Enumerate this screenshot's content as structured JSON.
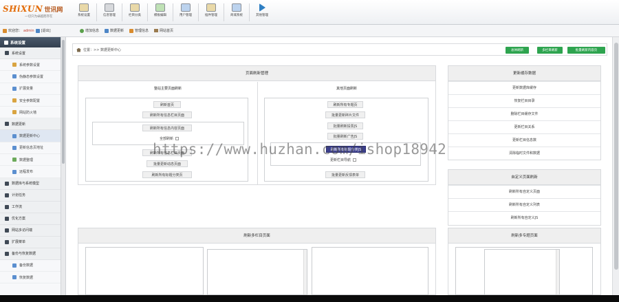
{
  "app": {
    "logo_main": "SHiXUN",
    "logo_cn": "世讯网",
    "logo_sub": "一切只为卓越而存在"
  },
  "topnav": [
    {
      "label": "系统设置",
      "icon": "settings-icon"
    },
    {
      "label": "信息管理",
      "icon": "calendar-icon"
    },
    {
      "label": "栏目分类",
      "icon": "folder-icon"
    },
    {
      "label": "模板编辑",
      "icon": "template-icon"
    },
    {
      "label": "用户管理",
      "icon": "monitor-icon"
    },
    {
      "label": "插件管理",
      "icon": "folder-icon"
    },
    {
      "label": "商城系统",
      "icon": "shop-icon"
    },
    {
      "label": "其他管理",
      "icon": "play-icon"
    }
  ],
  "subbar": {
    "welcome": "欢迎您：",
    "user": "admin",
    "logout": "[退出]",
    "quick": [
      "增加信息",
      "数据更新",
      "管理信息",
      "网站首页"
    ]
  },
  "sidebar": {
    "title": "系统设置",
    "groups": [
      {
        "label": "系统设置",
        "items": [
          "系统参数设置",
          "伪静态参数设置",
          "扩展变量",
          "安全参数配置",
          "网站防火墙"
        ]
      },
      {
        "label": "数据更新",
        "items": [
          "数据更新中心",
          "更新信息页地址",
          "数据整理",
          "远程发布"
        ]
      },
      {
        "label": "数据库与系统模型",
        "items": []
      },
      {
        "label": "计划任务",
        "items": []
      },
      {
        "label": "工作流",
        "items": []
      },
      {
        "label": "优化方案",
        "items": []
      },
      {
        "label": "网站多访问端",
        "items": []
      },
      {
        "label": "扩展菜单",
        "items": []
      },
      {
        "label": "备份与恢复数据",
        "items": [
          "备份数据",
          "恢复数据"
        ]
      }
    ]
  },
  "breadcrumb": {
    "text": "位置：>> 数据更新中心",
    "buttons": [
      "总体刷新",
      "多栏目刷新",
      "批量刷新内容页"
    ]
  },
  "page_refresh": {
    "title": "页面刷新管理",
    "left_col": {
      "title": "整站主要页面刷新",
      "buttons": [
        "刷新首页",
        "刷新所有信息栏目页面",
        "刷新所有信息内容页面",
        "刷新所有信息栏目页面",
        "批量更新动态页面",
        "刷新所有标题分类页"
      ],
      "option": "全部刷新"
    },
    "right_col": {
      "title": "其他页面刷新",
      "buttons": [
        "刷新所有专题页",
        "批量更新碎片文件",
        "批量刷新投票JS",
        "批量刷新广告JS",
        "刷新所有标题分类JS",
        "批量更新反馈表单"
      ],
      "option": "更新栏目导航"
    }
  },
  "cache_panel": {
    "title": "更新缓存数据",
    "rows": [
      "更新数据库缓存",
      "恢复栏目目录",
      "删除栏目缓存文件",
      "更新栏目关系",
      "更新栏目信息数",
      "清除临时文件和数据"
    ]
  },
  "custom_panel": {
    "title": "自定义页面刷新",
    "rows": [
      "刷新所有自定义页面",
      "刷新所有自定义列表",
      "刷新所有自定义JS"
    ]
  },
  "multi_col_panel": {
    "title": "刷新多栏目页面"
  },
  "multi_topic_panel": {
    "title": "刷新多专题页面"
  },
  "watermark": "https://www.huzhan.com/ishop18942"
}
